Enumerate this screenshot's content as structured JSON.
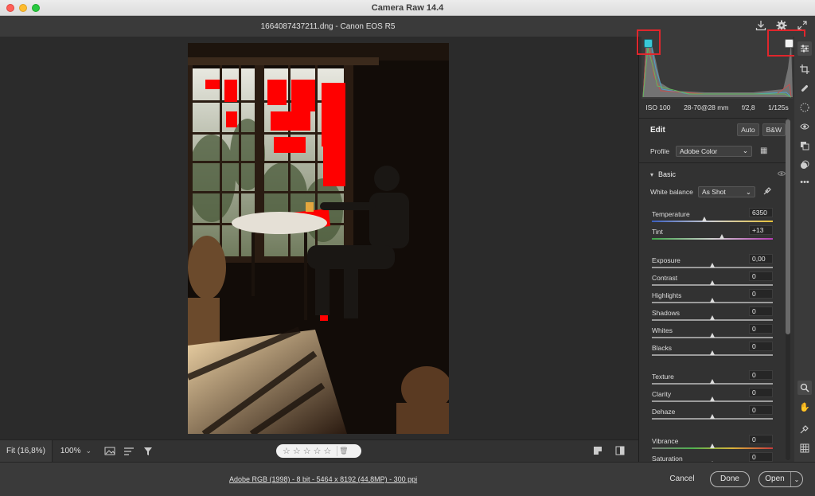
{
  "window": {
    "title": "Camera Raw 14.4"
  },
  "header": {
    "file_title": "1664087437211.dng  -  Canon EOS R5"
  },
  "icons": {
    "save": "download-icon",
    "settings": "gear-icon",
    "fullscreen": "expand-icon"
  },
  "exif": {
    "iso": "ISO 100",
    "lens": "28-70@28 mm",
    "aperture": "f/2,8",
    "shutter": "1/125s"
  },
  "edit": {
    "title": "Edit",
    "auto_label": "Auto",
    "bw_label": "B&W",
    "profile_label": "Profile",
    "profile_value": "Adobe Color",
    "section_label": "Basic",
    "wb_label": "White balance",
    "wb_value": "As Shot"
  },
  "sliders": [
    {
      "label": "Temperature",
      "value": "6350",
      "pos": 0.44
    },
    {
      "label": "Tint",
      "value": "+13",
      "pos": 0.58
    },
    {
      "label": "Exposure",
      "value": "0,00",
      "pos": 0.5
    },
    {
      "label": "Contrast",
      "value": "0",
      "pos": 0.5
    },
    {
      "label": "Highlights",
      "value": "0",
      "pos": 0.5
    },
    {
      "label": "Shadows",
      "value": "0",
      "pos": 0.5
    },
    {
      "label": "Whites",
      "value": "0",
      "pos": 0.5
    },
    {
      "label": "Blacks",
      "value": "0",
      "pos": 0.5
    },
    {
      "label": "Texture",
      "value": "0",
      "pos": 0.5
    },
    {
      "label": "Clarity",
      "value": "0",
      "pos": 0.5
    },
    {
      "label": "Dehaze",
      "value": "0",
      "pos": 0.5
    },
    {
      "label": "Vibrance",
      "value": "0",
      "pos": 0.5
    },
    {
      "label": "Saturation",
      "value": "0",
      "pos": 0.5
    }
  ],
  "canvas_bar": {
    "fit_label": "Fit (16,8%)",
    "zoom_label": "100%",
    "stars": [
      "☆",
      "☆",
      "☆",
      "☆",
      "☆"
    ]
  },
  "footer": {
    "info_link": "Adobe RGB (1998) - 8 bit - 5464 x 8192 (44,8MP) - 300 ppi",
    "cancel": "Cancel",
    "done": "Done",
    "open": "Open"
  },
  "colors": {
    "clip_shadow": "#39c8d6",
    "clip_highlight": "#f2f2f2",
    "overlay_red": "#ff0000",
    "annotation_red": "#e0262c"
  }
}
